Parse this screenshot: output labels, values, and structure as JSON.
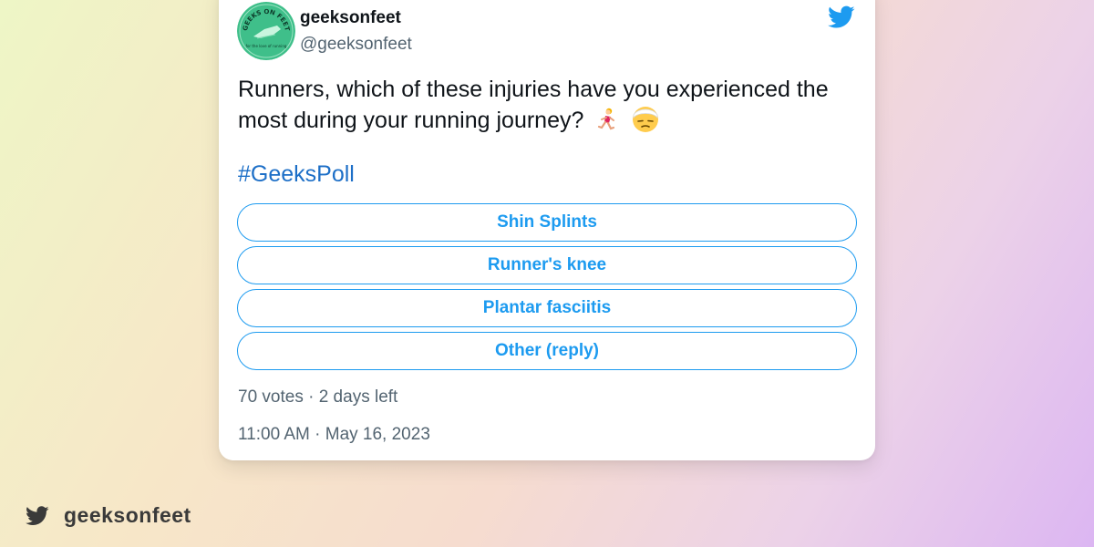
{
  "account": {
    "display_name": "geeksonfeet",
    "handle": "@geeksonfeet",
    "avatar_text_top": "GEEKS ON FEET",
    "avatar_text_bottom": "for the love of running"
  },
  "tweet": {
    "text": "Runners, which of these injuries have you experienced the most during your running journey?",
    "emojis": [
      "woman-running-emoji",
      "head-bandage-emoji"
    ],
    "hashtag": "#GeeksPoll"
  },
  "poll": {
    "options": [
      {
        "label": "Shin Splints"
      },
      {
        "label": "Runner's knee"
      },
      {
        "label": "Plantar fasciitis"
      },
      {
        "label": "Other (reply)"
      }
    ],
    "meta": "70 votes · 2 days left"
  },
  "timestamp": "11:00 AM · May 16, 2023",
  "footer": {
    "handle": "geeksonfeet"
  },
  "colors": {
    "twitter_blue": "#1d9bf0",
    "hashtag_blue": "#1d6fc7",
    "avatar_green": "#3fbf8a",
    "text_dark": "#0f1419",
    "text_gray": "#536471"
  }
}
